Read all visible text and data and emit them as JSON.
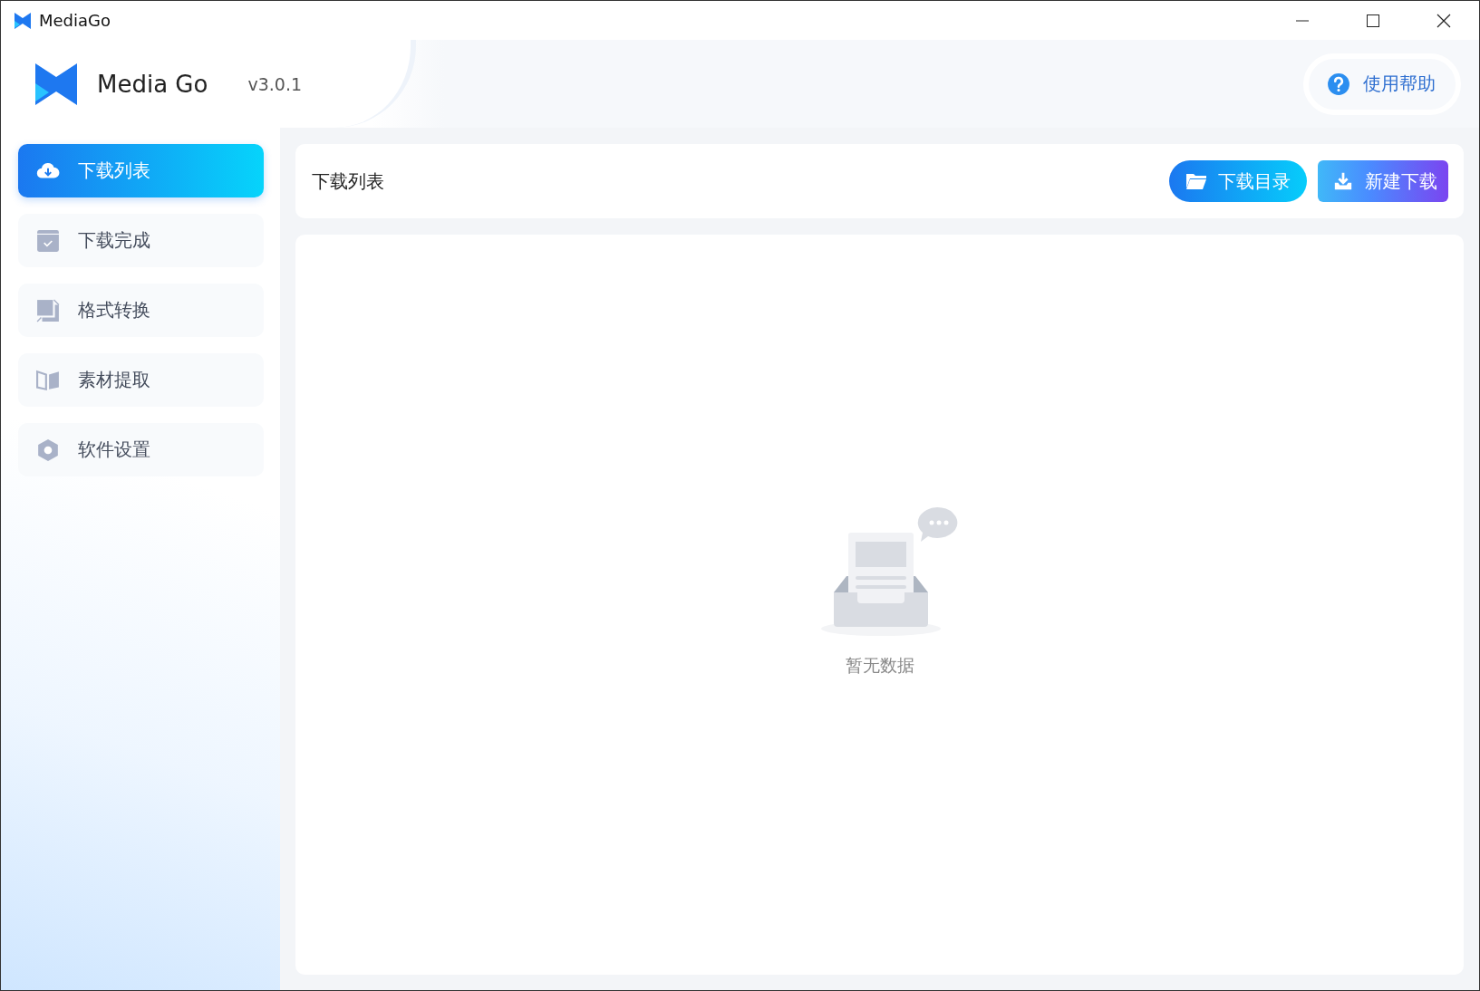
{
  "window": {
    "title": "MediaGo"
  },
  "header": {
    "app_name": "Media Go",
    "version": "v3.0.1",
    "help_label": "使用帮助"
  },
  "sidebar": {
    "items": [
      {
        "label": "下载列表",
        "kind": "cloud",
        "selected": true
      },
      {
        "label": "下载完成",
        "kind": "done",
        "selected": false
      },
      {
        "label": "格式转换",
        "kind": "convert",
        "selected": false
      },
      {
        "label": "素材提取",
        "kind": "extract",
        "selected": false
      },
      {
        "label": "软件设置",
        "kind": "settings",
        "selected": false
      }
    ]
  },
  "toolbar": {
    "title": "下载列表",
    "buttons": [
      {
        "label": "下载目录",
        "kind": "folder"
      },
      {
        "label": "新建下载",
        "kind": "download"
      }
    ]
  },
  "empty_state": {
    "message": "暂无数据"
  }
}
